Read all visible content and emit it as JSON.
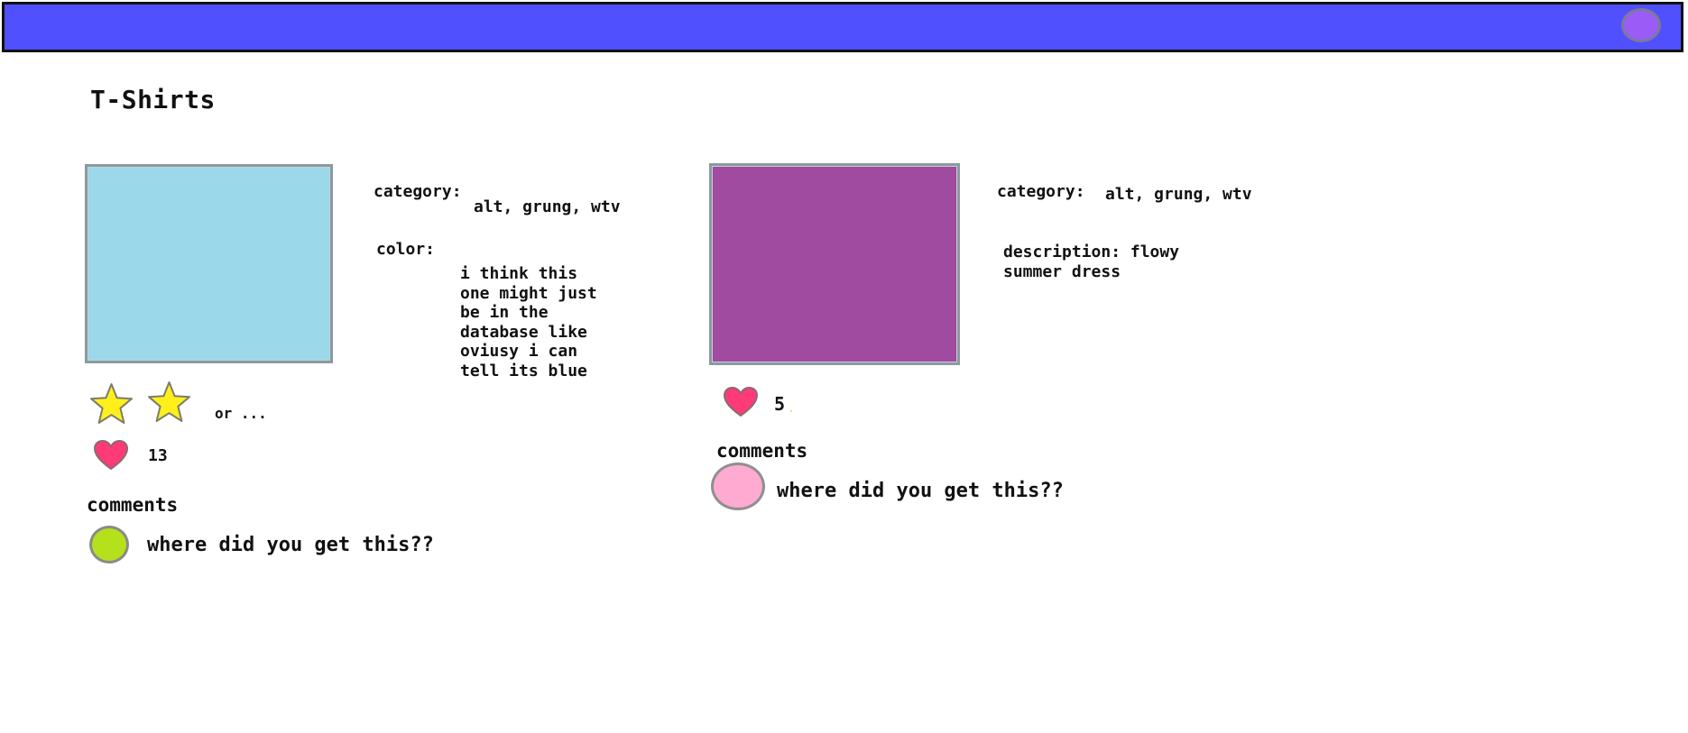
{
  "header": {
    "bar_color": "#5050ff",
    "avatar_color": "#9b5cf5"
  },
  "page": {
    "title": "T-Shirts"
  },
  "products": [
    {
      "image_color": "#9bd8ea",
      "category_label": "category:",
      "category_value": "alt, grung, wtv",
      "color_label": "color:",
      "color_value": "i think this\none might just\nbe in the\ndatabase like\noviusy i can\ntell its blue",
      "rating_icons": [
        "star-icon",
        "star-icon"
      ],
      "rating_suffix": "or ...",
      "likes": "13",
      "comments_heading": "comments",
      "comments": [
        {
          "avatar_color": "#b4e01c",
          "text": "where did you get this??"
        }
      ]
    },
    {
      "image_color": "#a04aa0",
      "category_label": "category:",
      "category_value": "alt, grung, wtv",
      "description": "description: flowy\nsummer dress",
      "likes": "5",
      "comments_heading": "comments",
      "comments": [
        {
          "avatar_color": "#ffaad0",
          "text": "where did you get this??"
        }
      ]
    }
  ],
  "colors": {
    "star": "#fff01c",
    "heart": "#ff3a78"
  }
}
